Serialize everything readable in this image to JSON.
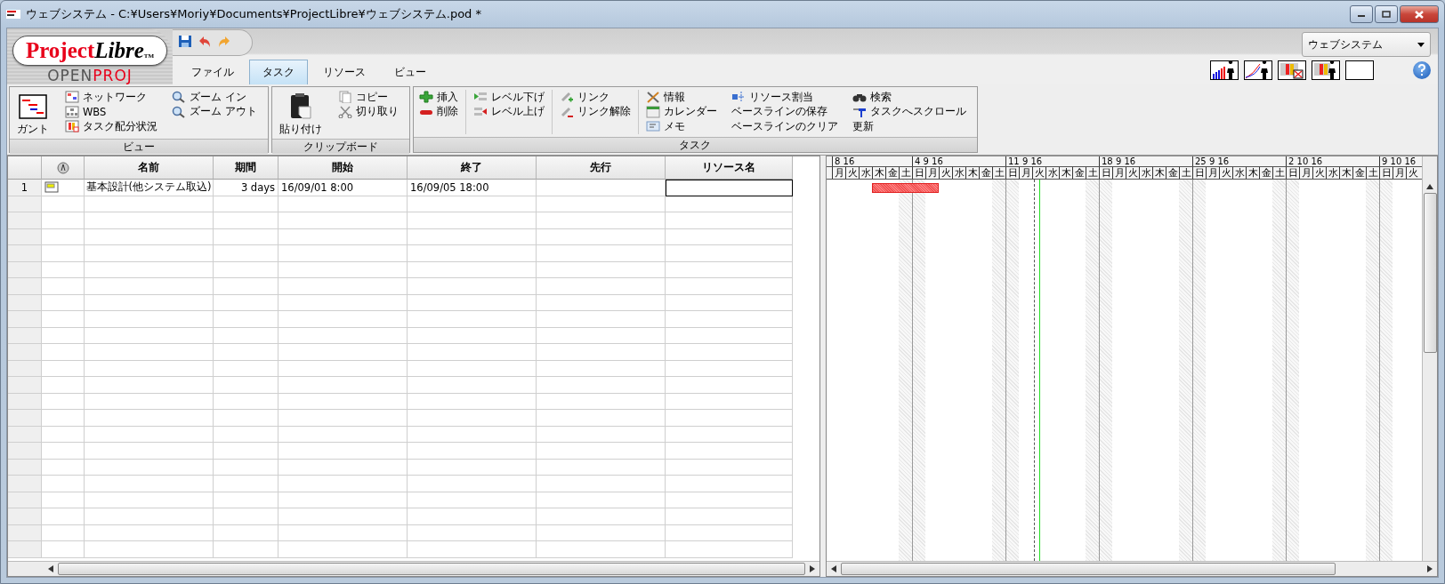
{
  "window": {
    "title": "ウェブシステム - C:¥Users¥Moriy¥Documents¥ProjectLibre¥ウェブシステム.pod *"
  },
  "logo": {
    "word_a": "Project",
    "word_b": "Libre",
    "tm": "TM",
    "sub_a": "OPEN",
    "sub_b": "PROJ"
  },
  "menu_tabs": [
    {
      "label": "ファイル",
      "selected": false
    },
    {
      "label": "タスク",
      "selected": true
    },
    {
      "label": "リソース",
      "selected": false
    },
    {
      "label": "ビュー",
      "selected": false
    }
  ],
  "project_selector": {
    "value": "ウェブシステム"
  },
  "ribbon": [
    {
      "label": "ビュー",
      "columns": [
        [
          {
            "label": "ガント",
            "kind": "large"
          }
        ],
        [
          {
            "label": "ネットワーク",
            "kind": "small"
          },
          {
            "label": "WBS",
            "kind": "small"
          },
          {
            "label": "タスク配分状況",
            "kind": "small"
          }
        ],
        [
          {
            "label": "ズーム イン",
            "kind": "small"
          },
          {
            "label": "ズーム アウト",
            "kind": "small"
          }
        ]
      ]
    },
    {
      "label": "クリップボード",
      "columns": [
        [
          {
            "label": "貼り付け",
            "kind": "large"
          }
        ],
        [
          {
            "label": "コピー",
            "kind": "small"
          },
          {
            "label": "切り取り",
            "kind": "small"
          }
        ]
      ]
    },
    {
      "label": "タスク",
      "columns": [
        [
          {
            "label": "挿入",
            "kind": "small"
          },
          {
            "label": "削除",
            "kind": "small"
          }
        ],
        [
          {
            "label": "レベル下げ",
            "kind": "small"
          },
          {
            "label": "レベル上げ",
            "kind": "small"
          }
        ],
        [
          {
            "label": "リンク",
            "kind": "small"
          },
          {
            "label": "リンク解除",
            "kind": "small"
          }
        ],
        [
          {
            "label": "情報",
            "kind": "small"
          },
          {
            "label": "カレンダー",
            "kind": "small"
          },
          {
            "label": "メモ",
            "kind": "small"
          }
        ],
        [
          {
            "label": "リソース割当",
            "kind": "small"
          },
          {
            "label": "ベースラインの保存",
            "kind": "small"
          },
          {
            "label": "ベースラインのクリア",
            "kind": "small"
          }
        ],
        [
          {
            "label": "検索",
            "kind": "small"
          },
          {
            "label": "タスクへスクロール",
            "kind": "small"
          },
          {
            "label": "更新",
            "kind": "small"
          }
        ]
      ]
    }
  ],
  "table": {
    "columns": [
      "名前",
      "期間",
      "開始",
      "終了",
      "先行",
      "リソース名"
    ],
    "rows": [
      {
        "number": "1",
        "name": "基本設計(他システム取込)",
        "duration": "3 days",
        "start": "16/09/01 8:00",
        "finish": "16/09/05 18:00",
        "resource_focused": true
      }
    ]
  },
  "gantt": {
    "weeks": [
      {
        "label": "8 16",
        "days": [
          {
            "label": "月",
            "nonworking": false,
            "task_bar": false,
            "today": false
          },
          {
            "label": "火",
            "nonworking": false,
            "task_bar": false,
            "today": false
          },
          {
            "label": "水",
            "nonworking": false,
            "task_bar": false,
            "today": false
          },
          {
            "label": "木",
            "nonworking": false,
            "task_bar": true,
            "today": false
          },
          {
            "label": "金",
            "nonworking": false,
            "task_bar": true,
            "today": false
          },
          {
            "label": "土",
            "nonworking": true,
            "task_bar": true,
            "today": false
          }
        ]
      },
      {
        "label": "4 9 16",
        "days": [
          {
            "label": "日",
            "nonworking": true,
            "task_bar": true,
            "today": false
          },
          {
            "label": "月",
            "nonworking": false,
            "task_bar": true,
            "today": false
          },
          {
            "label": "火",
            "nonworking": false,
            "task_bar": false,
            "today": false
          },
          {
            "label": "水",
            "nonworking": false,
            "task_bar": false,
            "today": false
          },
          {
            "label": "木",
            "nonworking": false,
            "task_bar": false,
            "today": false
          },
          {
            "label": "金",
            "nonworking": false,
            "task_bar": false,
            "today": false
          },
          {
            "label": "土",
            "nonworking": true,
            "task_bar": false,
            "today": false
          }
        ]
      },
      {
        "label": "11 9 16",
        "days": [
          {
            "label": "日",
            "nonworking": true,
            "task_bar": false,
            "today": false
          },
          {
            "label": "月",
            "nonworking": false,
            "task_bar": false,
            "today": false
          },
          {
            "label": "火",
            "nonworking": false,
            "task_bar": false,
            "today": true
          },
          {
            "label": "水",
            "nonworking": false,
            "task_bar": false,
            "today": false
          },
          {
            "label": "木",
            "nonworking": false,
            "task_bar": false,
            "today": false
          },
          {
            "label": "金",
            "nonworking": false,
            "task_bar": false,
            "today": false
          },
          {
            "label": "土",
            "nonworking": true,
            "task_bar": false,
            "today": false
          }
        ]
      },
      {
        "label": "18 9 16",
        "days": [
          {
            "label": "日",
            "nonworking": true,
            "task_bar": false,
            "today": false
          },
          {
            "label": "月",
            "nonworking": false,
            "task_bar": false,
            "today": false
          },
          {
            "label": "火",
            "nonworking": false,
            "task_bar": false,
            "today": false
          },
          {
            "label": "水",
            "nonworking": false,
            "task_bar": false,
            "today": false
          },
          {
            "label": "木",
            "nonworking": false,
            "task_bar": false,
            "today": false
          },
          {
            "label": "金",
            "nonworking": false,
            "task_bar": false,
            "today": false
          },
          {
            "label": "土",
            "nonworking": true,
            "task_bar": false,
            "today": false
          }
        ]
      },
      {
        "label": "25 9 16",
        "days": [
          {
            "label": "日",
            "nonworking": true,
            "task_bar": false,
            "today": false
          },
          {
            "label": "月",
            "nonworking": false,
            "task_bar": false,
            "today": false
          },
          {
            "label": "火",
            "nonworking": false,
            "task_bar": false,
            "today": false
          },
          {
            "label": "水",
            "nonworking": false,
            "task_bar": false,
            "today": false
          },
          {
            "label": "木",
            "nonworking": false,
            "task_bar": false,
            "today": false
          },
          {
            "label": "金",
            "nonworking": false,
            "task_bar": false,
            "today": false
          },
          {
            "label": "土",
            "nonworking": true,
            "task_bar": false,
            "today": false
          }
        ]
      },
      {
        "label": "2 10 16",
        "days": [
          {
            "label": "日",
            "nonworking": true,
            "task_bar": false,
            "today": false
          },
          {
            "label": "月",
            "nonworking": false,
            "task_bar": false,
            "today": false
          },
          {
            "label": "火",
            "nonworking": false,
            "task_bar": false,
            "today": false
          },
          {
            "label": "水",
            "nonworking": false,
            "task_bar": false,
            "today": false
          },
          {
            "label": "木",
            "nonworking": false,
            "task_bar": false,
            "today": false
          },
          {
            "label": "金",
            "nonworking": false,
            "task_bar": false,
            "today": false
          },
          {
            "label": "土",
            "nonworking": true,
            "task_bar": false,
            "today": false
          }
        ]
      },
      {
        "label": "9 10 16",
        "days": [
          {
            "label": "日",
            "nonworking": true,
            "task_bar": false,
            "today": false
          },
          {
            "label": "月",
            "nonworking": false,
            "task_bar": false,
            "today": false
          },
          {
            "label": "火",
            "nonworking": false,
            "task_bar": false,
            "today": false
          }
        ]
      }
    ]
  }
}
